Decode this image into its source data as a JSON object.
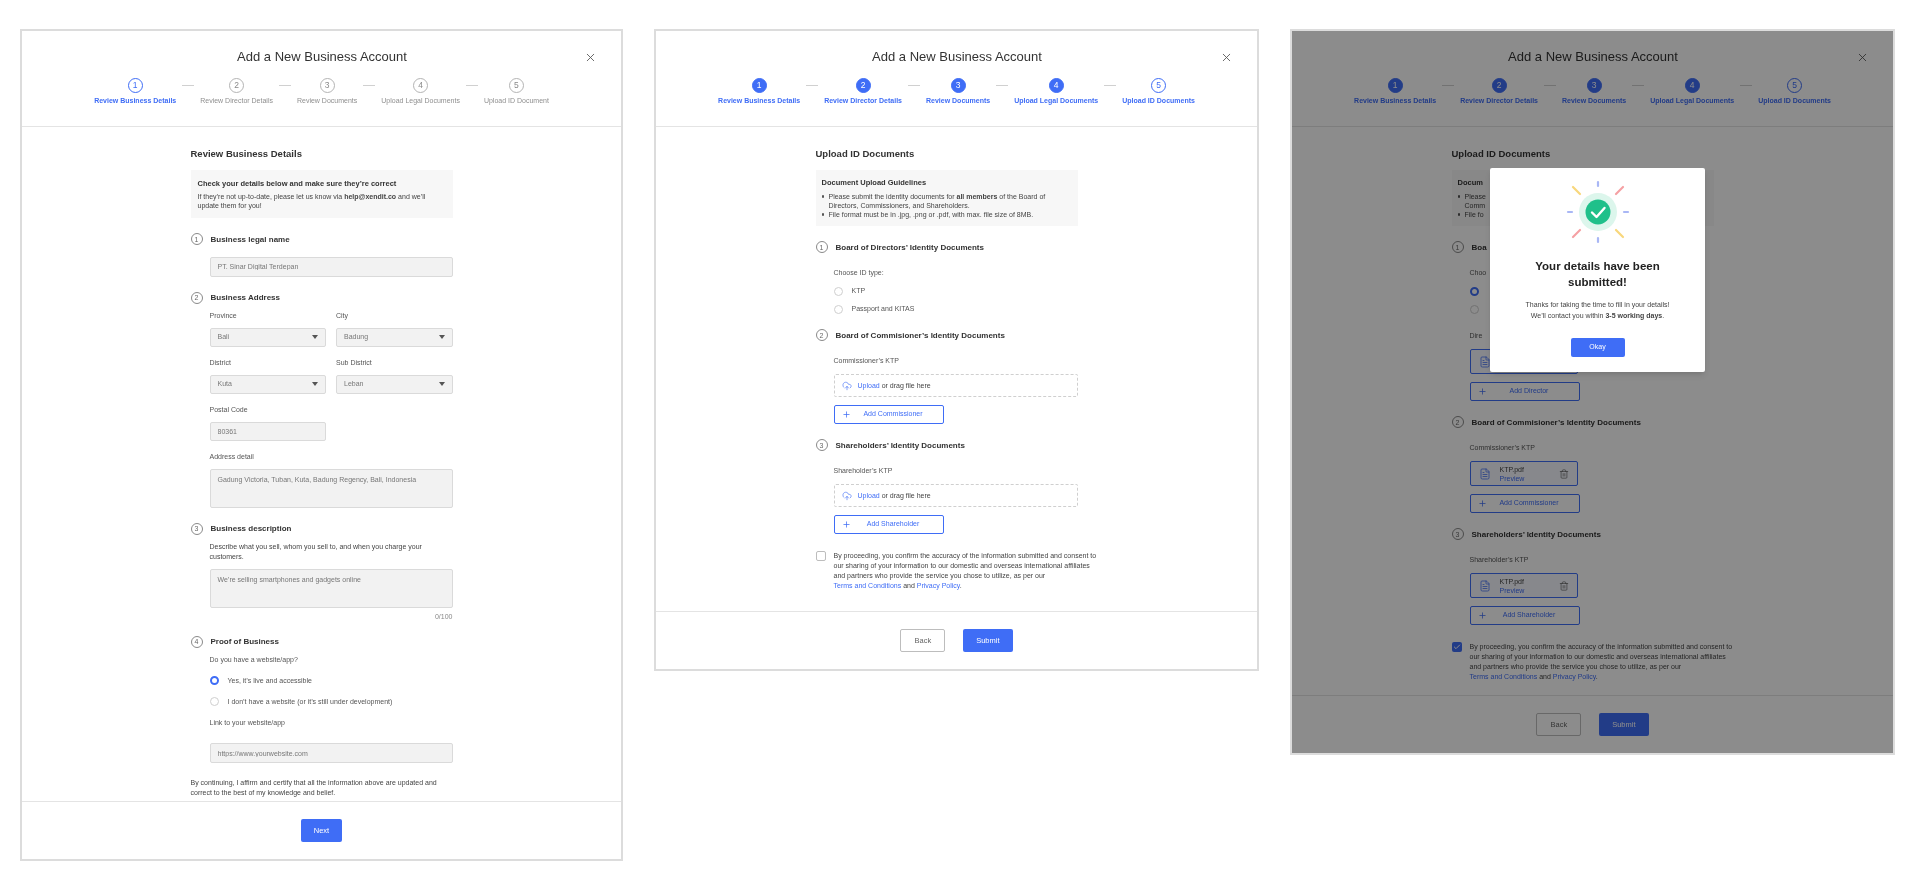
{
  "screens": [
    {
      "kind": "business_details",
      "title": "Add a New Business Account",
      "steps": [
        {
          "number": "1",
          "label": "Review Business Details",
          "completed": false,
          "selected": true
        },
        {
          "number": "2",
          "label": "Review Director Details",
          "completed": false,
          "selected": false
        },
        {
          "number": "3",
          "label": "Review Documents",
          "completed": false,
          "selected": false
        },
        {
          "number": "4",
          "label": "Upload Legal Documents",
          "completed": false,
          "selected": false
        },
        {
          "number": "5",
          "label": "Upload ID Document",
          "completed": false,
          "selected": false
        }
      ],
      "heading": "Review Business Details",
      "info_box": {
        "title": "Check your details below and make sure they’re correct",
        "text": "If they’re not up-to-date, please let us know via **help@xendit.co** and we’ll update them for you!"
      },
      "sections": [
        {
          "number": "1",
          "title": "Business legal name",
          "items": [
            {
              "kind": "input",
              "value": "PT. Sinar Digital Terdepan"
            }
          ]
        },
        {
          "number": "2",
          "title": "Business Address",
          "items": [
            {
              "kind": "select",
              "label": "Province",
              "value": "Bali"
            },
            {
              "kind": "select",
              "label": "City",
              "value": "Badung"
            },
            {
              "kind": "select",
              "label": "District",
              "value": "Kuta"
            },
            {
              "kind": "select",
              "label": "Sub District",
              "value": "Leban"
            },
            {
              "kind": "short_input",
              "label": "Postal Code",
              "value": "80361"
            },
            {
              "kind": "textarea",
              "label": "Address detail",
              "value": "Gadung Victoria, Tuban, Kuta, Badung Regency, Bali, Indonesia"
            }
          ]
        },
        {
          "number": "3",
          "title": "Business description",
          "items": [
            {
              "kind": "text",
              "text": "Describe what you sell, whom you sell to, and when you charge your customers."
            },
            {
              "kind": "textarea",
              "placeholder": "We’re selling smartphones and gadgets online",
              "counter": "0/100"
            }
          ]
        },
        {
          "number": "4",
          "title": "Proof of Business",
          "items": [
            {
              "kind": "label",
              "text": "Do you have a website/app?"
            },
            {
              "kind": "radio",
              "label": "Yes, it’s live and accessible",
              "selected": true
            },
            {
              "kind": "radio",
              "label": "I don’t have a website (or it’s still under development)",
              "selected": false
            },
            {
              "kind": "label",
              "text": "Link to your website/app"
            },
            {
              "kind": "input",
              "placeholder": "https://www.yourwebsite.com"
            }
          ]
        }
      ],
      "affirmation": "By continuing, I affirm and certify that all the information above are updated and correct to the best of my knowledge and belief.",
      "buttons": [
        {
          "kind": "primary",
          "label": "Next"
        }
      ]
    },
    {
      "kind": "upload_id",
      "title": "Add a New Business Account",
      "steps": [
        {
          "number": "1",
          "label": "Review Business Details",
          "completed": true,
          "selected": false
        },
        {
          "number": "2",
          "label": "Review Director Details",
          "completed": true,
          "selected": false
        },
        {
          "number": "3",
          "label": "Review Documents",
          "completed": true,
          "selected": false
        },
        {
          "number": "4",
          "label": "Upload Legal Documents",
          "completed": true,
          "selected": false
        },
        {
          "number": "5",
          "label": "Upload ID Documents",
          "completed": false,
          "selected": true
        }
      ],
      "heading": "Upload ID Documents",
      "guidelines": {
        "title": "Document Upload Guidelines",
        "lines": [
          {
            "bullet": true,
            "text": "Please submit the identity documents for **all members** of the Board of Directors, Commissioners, and Shareholders."
          },
          {
            "bullet": true,
            "text": "File format must be in .jpg, .png or .pdf, with max. file size of 8MB."
          }
        ]
      },
      "sections": [
        {
          "number": "1",
          "title": "Board of Directors’ Identity Documents",
          "items": [
            {
              "kind": "label",
              "text": "Choose ID type:"
            },
            {
              "kind": "radio",
              "label": "KTP",
              "selected": false
            },
            {
              "kind": "radio",
              "label": "Passport and KITAS",
              "selected": false
            }
          ]
        },
        {
          "number": "2",
          "title": "Board of Commisioner’s Identity Documents",
          "items": [
            {
              "kind": "label",
              "text": "Commissioner’s KTP"
            },
            {
              "kind": "dropzone",
              "link": "Upload",
              "text": "or drag file here"
            },
            {
              "kind": "add_button",
              "label": "Add Commissioner"
            }
          ]
        },
        {
          "number": "3",
          "title": "Shareholders’ Identity Documents",
          "items": [
            {
              "kind": "label",
              "text": "Shareholder’s KTP"
            },
            {
              "kind": "dropzone",
              "link": "Upload",
              "text": "or drag file here"
            },
            {
              "kind": "add_button",
              "label": "Add Shareholder"
            }
          ]
        }
      ],
      "consent": {
        "checked": false,
        "text": "By proceeding, you confirm the accuracy of the information submitted and consent to our sharing of your information to our domestic and overseas international affiliates and partners who provide the service you chose to utilize, as per our",
        "terms_link": "Terms and Conditions",
        "joiner": "and",
        "privacy_link": "Privacy Policy",
        "end": "."
      },
      "buttons": [
        {
          "kind": "secondary",
          "label": "Back"
        },
        {
          "kind": "primary",
          "label": "Submit"
        }
      ]
    },
    {
      "kind": "upload_id",
      "title": "Add a New Business Account",
      "steps": [
        {
          "number": "1",
          "label": "Review Business Details",
          "completed": true,
          "selected": false
        },
        {
          "number": "2",
          "label": "Review Director Details",
          "completed": true,
          "selected": false
        },
        {
          "number": "3",
          "label": "Review Documents",
          "completed": true,
          "selected": false
        },
        {
          "number": "4",
          "label": "Upload Legal Documents",
          "completed": true,
          "selected": false
        },
        {
          "number": "5",
          "label": "Upload ID Documents",
          "completed": false,
          "selected": true
        }
      ],
      "heading": "Upload ID Documents",
      "guidelines": {
        "title": "Docum",
        "lines": [
          {
            "bullet": true,
            "text": "Please"
          },
          {
            "bullet": false,
            "text": "Comm"
          },
          {
            "bullet": true,
            "text": "File fo"
          }
        ]
      },
      "sections": [
        {
          "number": "1",
          "title": "Boa",
          "items": [
            {
              "kind": "label",
              "text": "Choo"
            },
            {
              "kind": "radio",
              "selected": true
            },
            {
              "kind": "radio",
              "selected": false
            },
            {
              "kind": "label",
              "text": "Dire"
            },
            {
              "kind": "file_card"
            },
            {
              "kind": "add_button",
              "label": "Add Director"
            }
          ]
        },
        {
          "number": "2",
          "title": "Board of Commisioner’s Identity Documents",
          "items": [
            {
              "kind": "label",
              "text": "Commissioner’s KTP"
            },
            {
              "kind": "file_card",
              "file": "KTP.pdf",
              "link": "Preview"
            },
            {
              "kind": "add_button",
              "label": "Add Commissioner"
            }
          ]
        },
        {
          "number": "3",
          "title": "Shareholders’ Identity Documents",
          "items": [
            {
              "kind": "label",
              "text": "Shareholder’s KTP"
            },
            {
              "kind": "file_card",
              "file": "KTP.pdf",
              "link": "Preview"
            },
            {
              "kind": "add_button",
              "label": "Add Shareholder"
            }
          ]
        }
      ],
      "consent": {
        "checked": true,
        "text": "By proceeding, you confirm the accuracy of the information submitted and consent to our sharing of your information to our domestic and overseas international affiliates and partners who provide the service you chose to utilize, as per our",
        "terms_link": "Terms and Conditions",
        "joiner": "and",
        "privacy_link": "Privacy Policy",
        "end": "."
      },
      "buttons": [
        {
          "kind": "secondary",
          "label": "Back"
        },
        {
          "kind": "primary",
          "label": "Submit"
        }
      ],
      "modal": {
        "title": "Your details have been submitted!",
        "lines": [
          "Thanks for taking the time to fill in your details!",
          "We’ll contact you within **3-5 working days**."
        ],
        "button": "Okay"
      }
    }
  ]
}
